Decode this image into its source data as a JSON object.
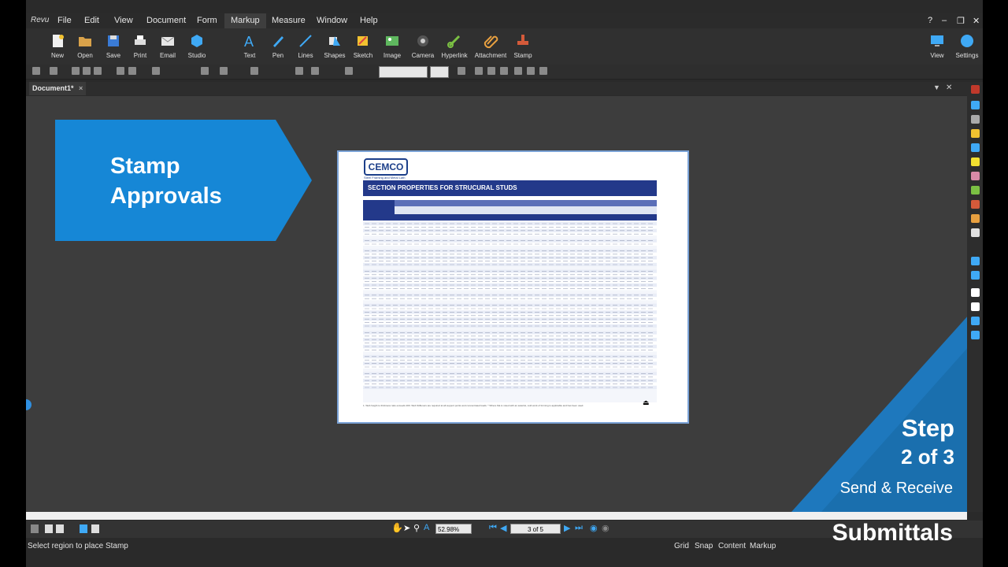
{
  "app": {
    "logo": "Revu"
  },
  "menu": [
    {
      "label": "File"
    },
    {
      "label": "Edit"
    },
    {
      "label": "View"
    },
    {
      "label": "Document"
    },
    {
      "label": "Form"
    },
    {
      "label": "Markup"
    },
    {
      "label": "Measure"
    },
    {
      "label": "Window"
    },
    {
      "label": "Help"
    }
  ],
  "window_controls": {
    "help": "?",
    "minimize": "–",
    "restore": "❐",
    "close": "✕"
  },
  "ribbon": {
    "file_group": [
      "New",
      "Open",
      "Save",
      "Print",
      "Email",
      "Studio"
    ],
    "markup_group": [
      "Text",
      "Pen",
      "Lines",
      "Shapes",
      "Sketch",
      "Image",
      "Camera",
      "Hyperlink",
      "Attachment",
      "Stamp"
    ],
    "right_group": [
      "View",
      "Settings"
    ]
  },
  "tab": {
    "label": "Document1*",
    "close": "×"
  },
  "page_content": {
    "logo": "CEMCO",
    "logo_sub": "Steel Framing and Metal Lath",
    "title": "SECTION PROPERTIES FOR STRUCURAL STUDS",
    "footnotes": "1. Web height to thickness ratio exceeds 200. Web Stiffeners are required at all support points and concentrated loads. * Where Ma is noted with an asterisk, cold work of forming is applicable and has been used."
  },
  "callout": {
    "line1": "Stamp",
    "line2": "Approvals"
  },
  "step": {
    "title": "Step",
    "number": "2 of 3",
    "subtitle": "Send & Receive",
    "banner": "Submittals"
  },
  "navbar": {
    "zoom": "52.98%",
    "page": "3 of 5"
  },
  "status": {
    "message": "Select region to place Stamp",
    "items": [
      "Grid",
      "Snap",
      "Content",
      "Markup"
    ]
  },
  "colors": {
    "accent": "#1687d6",
    "title_bar": "#23398a",
    "step_triangle": "#1e78bd"
  }
}
